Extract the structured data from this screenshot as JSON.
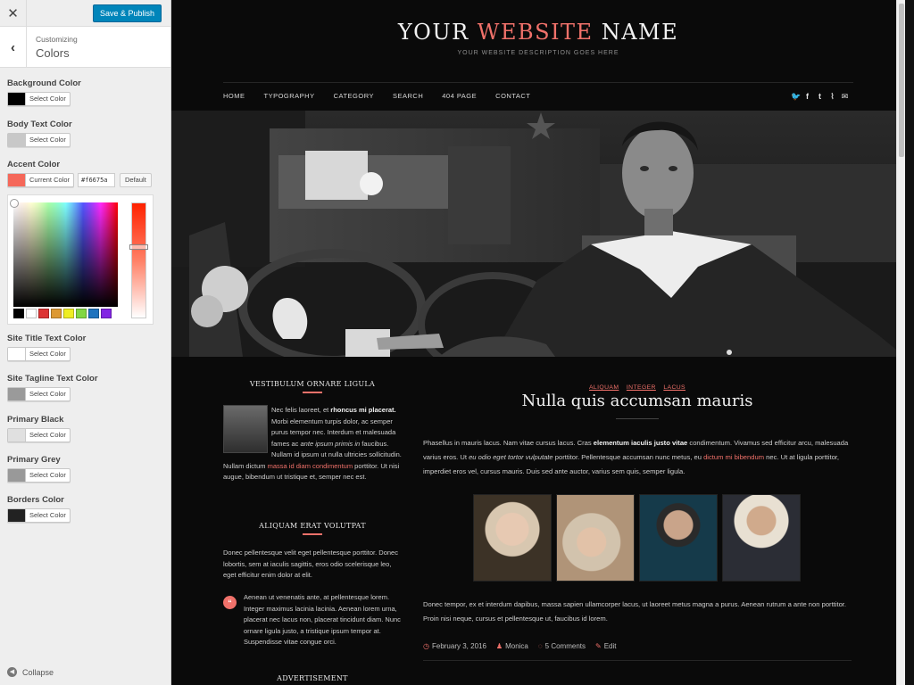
{
  "customizer": {
    "close_icon": "close-icon",
    "publish_label": "Save & Publish",
    "back_icon": "chevron-left-icon",
    "breadcrumb": "Customizing",
    "section_title": "Colors",
    "controls": [
      {
        "label": "Background Color",
        "button": "Select Color",
        "color": "#000000"
      },
      {
        "label": "Body Text Color",
        "button": "Select Color",
        "color": "#c8c8c8"
      },
      {
        "label": "Accent Color",
        "button": "Current Color",
        "color": "#f5685a",
        "hex": "#f6675a",
        "default_label": "Default"
      },
      {
        "label": "Site Title Text Color",
        "button": "Select Color",
        "color": "#ffffff"
      },
      {
        "label": "Site Tagline Text Color",
        "button": "Select Color",
        "color": "#9a9a9a"
      },
      {
        "label": "Primary Black",
        "button": "Select Color",
        "color": "#e0e0e0"
      },
      {
        "label": "Primary Grey",
        "button": "Select Color",
        "color": "#999999"
      },
      {
        "label": "Borders Color",
        "button": "Select Color",
        "color": "#222222"
      }
    ],
    "palette": [
      "#000000",
      "#ffffff",
      "#dd3333",
      "#dd9933",
      "#eeee22",
      "#81d742",
      "#1e73be",
      "#8224e3"
    ],
    "collapse_label": "Collapse"
  },
  "site": {
    "title_part1": "YOUR",
    "title_part2": "WEBSITE",
    "title_part3": "NAME",
    "tagline": "YOUR WEBSITE DESCRIPTION GOES HERE",
    "nav": [
      "HOME",
      "TYPOGRAPHY",
      "CATEGORY",
      "SEARCH",
      "404 PAGE",
      "CONTACT"
    ],
    "social_glyphs": [
      "t",
      "f",
      "t",
      "r",
      "e"
    ],
    "social_icons": [
      "twitter-icon",
      "facebook-icon",
      "tumblr-icon",
      "rss-icon",
      "email-icon"
    ]
  },
  "widgets": {
    "w1_title": "VESTIBULUM ORNARE LIGULA",
    "w1_text_a": "Nec felis laoreet, et ",
    "w1_text_b": "rhoncus mi placerat.",
    "w1_text_c": " Morbi elementum turpis dolor, ac semper purus tempor nec. Interdum et malesuada fames ac ",
    "w1_text_d": "ante ipsum primis in",
    "w1_text_e": " faucibus. Nullam id ipsum ut nulla ultricies sollicitudin. Nullam dictum ",
    "w1_text_f": "massa id diam condimentum",
    "w1_text_g": " porttitor. Ut nisi augue, bibendum ut tristique et, semper nec est.",
    "w2_title": "ALIQUAM ERAT VOLUTPAT",
    "w2_text": "Donec pellentesque velit eget pellentesque porttitor. Donec lobortis, sem at iaculis sagittis, eros odio scelerisque leo, eget efficitur enim dolor at elit.",
    "quote_glyph": "“",
    "w2_quote": "Aenean ut venenatis ante, at pellentesque lorem. Integer maximus lacinia lacinia. Aenean lorem urna, placerat nec lacus non, placerat tincidunt diam. Nunc ornare ligula justo, a tristique ipsum tempor at. Suspendisse vitae congue orci.",
    "w3_title": "ADVERTISEMENT"
  },
  "post": {
    "categories": [
      "ALIQUAM",
      "INTEGER",
      "LACUS"
    ],
    "title": "Nulla quis accumsan mauris",
    "p1_a": "Phasellus in mauris lacus. Nam vitae cursus lacus. Cras ",
    "p1_b": "elementum iaculis justo vitae",
    "p1_c": " condimentum. Vivamus sed efficitur arcu, malesuada varius eros. Ut ",
    "p1_d": "eu odio eget tortor vulputate",
    "p1_e": " porttitor. Pellentesque accumsan nunc metus, eu ",
    "p1_f": "dictum mi bibendum",
    "p1_g": " nec. Ut at ligula porttitor, imperdiet eros vel, cursus mauris. Duis sed ante auctor, varius sem quis, semper ligula.",
    "p2": "Donec tempor, ex et interdum dapibus, massa sapien ullamcorper lacus, ut laoreet metus magna a purus. Aenean rutrum a ante non porttitor. Proin nisi neque, cursus et pellentesque ut, faucibus id lorem.",
    "date": "February 3, 2016",
    "author": "Monica",
    "comments": "5 Comments",
    "edit": "Edit"
  }
}
